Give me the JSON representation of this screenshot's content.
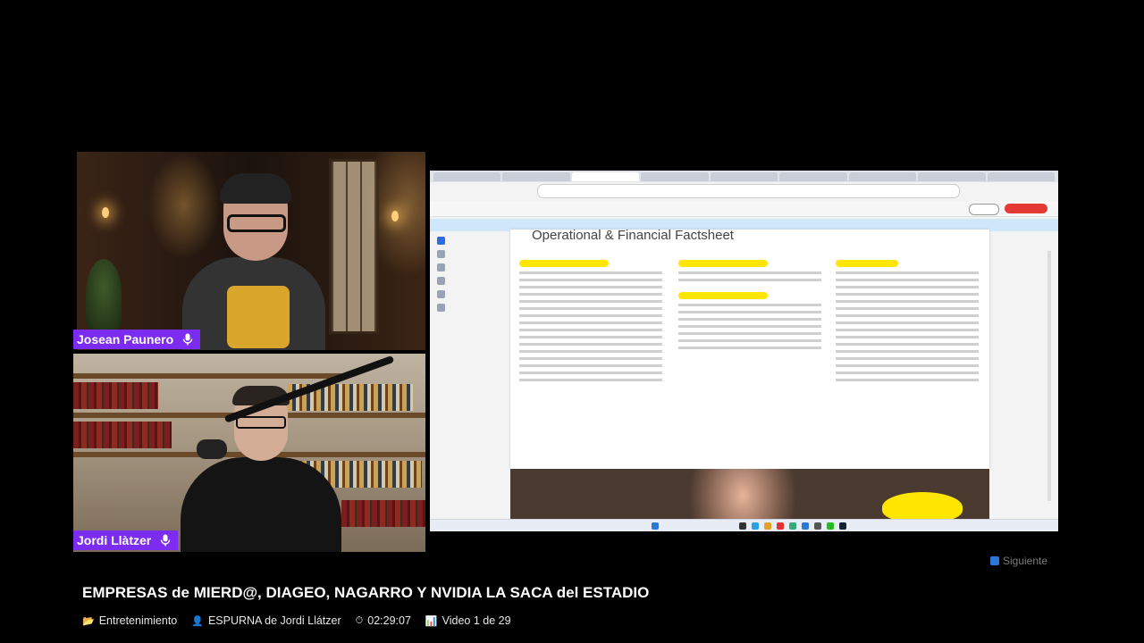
{
  "speakers": [
    {
      "name": "Josean Paunero"
    },
    {
      "name": "Jordi Llàtzer"
    }
  ],
  "shared_screen": {
    "document_title": "Operational & Financial Factsheet"
  },
  "next_button": {
    "label": "Siguiente",
    "icon": "next-track-icon"
  },
  "video": {
    "title": "EMPRESAS de MIERD@, DIAGEO, NAGARRO Y NVIDIA LA SACA del ESTADIO",
    "meta": {
      "category": {
        "icon": "folder-icon",
        "label": "Entretenimiento"
      },
      "channel": {
        "icon": "person-icon",
        "label": "ESPURNA de Jordi Llátzer"
      },
      "duration": {
        "icon": "stopwatch-icon",
        "label": "02:29:07"
      },
      "position": {
        "icon": "chart-icon",
        "label": "Video 1 de 29"
      }
    }
  },
  "colors": {
    "nametag": "#7b2cf0",
    "accent_yellow": "#ffe600",
    "background": "#000000"
  }
}
